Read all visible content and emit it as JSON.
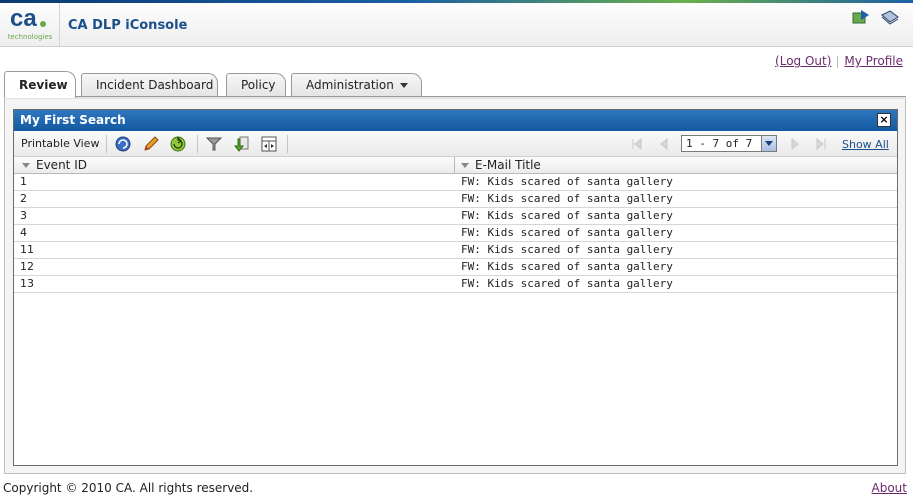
{
  "brand": {
    "logo_text": "ca",
    "logo_subtitle": "technologies",
    "app_title": "CA DLP iConsole"
  },
  "header_icons": [
    "download-arrow-icon",
    "book-icon"
  ],
  "user_links": {
    "logout": "(Log Out)",
    "profile": "My Profile"
  },
  "tabs": [
    {
      "label": "Review",
      "active": true
    },
    {
      "label": "Incident Dashboard",
      "active": false
    },
    {
      "label": "Policy",
      "active": false
    },
    {
      "label": "Administration",
      "active": false,
      "dropdown": true
    }
  ],
  "panel": {
    "title": "My First Search",
    "close_label": "×"
  },
  "toolbar": {
    "printable_view": "Printable View",
    "icons": [
      "refresh-icon",
      "edit-pencil-icon",
      "reload-icon",
      "filter-icon",
      "export-icon",
      "columns-icon"
    ],
    "pager": {
      "selected": "1 - 7 of 7",
      "show_all": "Show All"
    }
  },
  "table": {
    "columns": [
      "Event ID",
      "E-Mail Title"
    ],
    "rows": [
      [
        "1",
        "FW: Kids scared of santa gallery"
      ],
      [
        "2",
        "FW: Kids scared of santa gallery"
      ],
      [
        "3",
        "FW: Kids scared of santa gallery"
      ],
      [
        "4",
        "FW: Kids scared of santa gallery"
      ],
      [
        "11",
        "FW: Kids scared of santa gallery"
      ],
      [
        "12",
        "FW: Kids scared of santa gallery"
      ],
      [
        "13",
        "FW: Kids scared of santa gallery"
      ]
    ]
  },
  "footer": {
    "copyright": "Copyright © 2010 CA. All rights reserved.",
    "about": "About"
  },
  "colors": {
    "panel_title_bg": "#1b5fa6",
    "app_title": "#1b4f8a",
    "link_visited": "#6b2b6b",
    "logo_green": "#6aa84f"
  }
}
